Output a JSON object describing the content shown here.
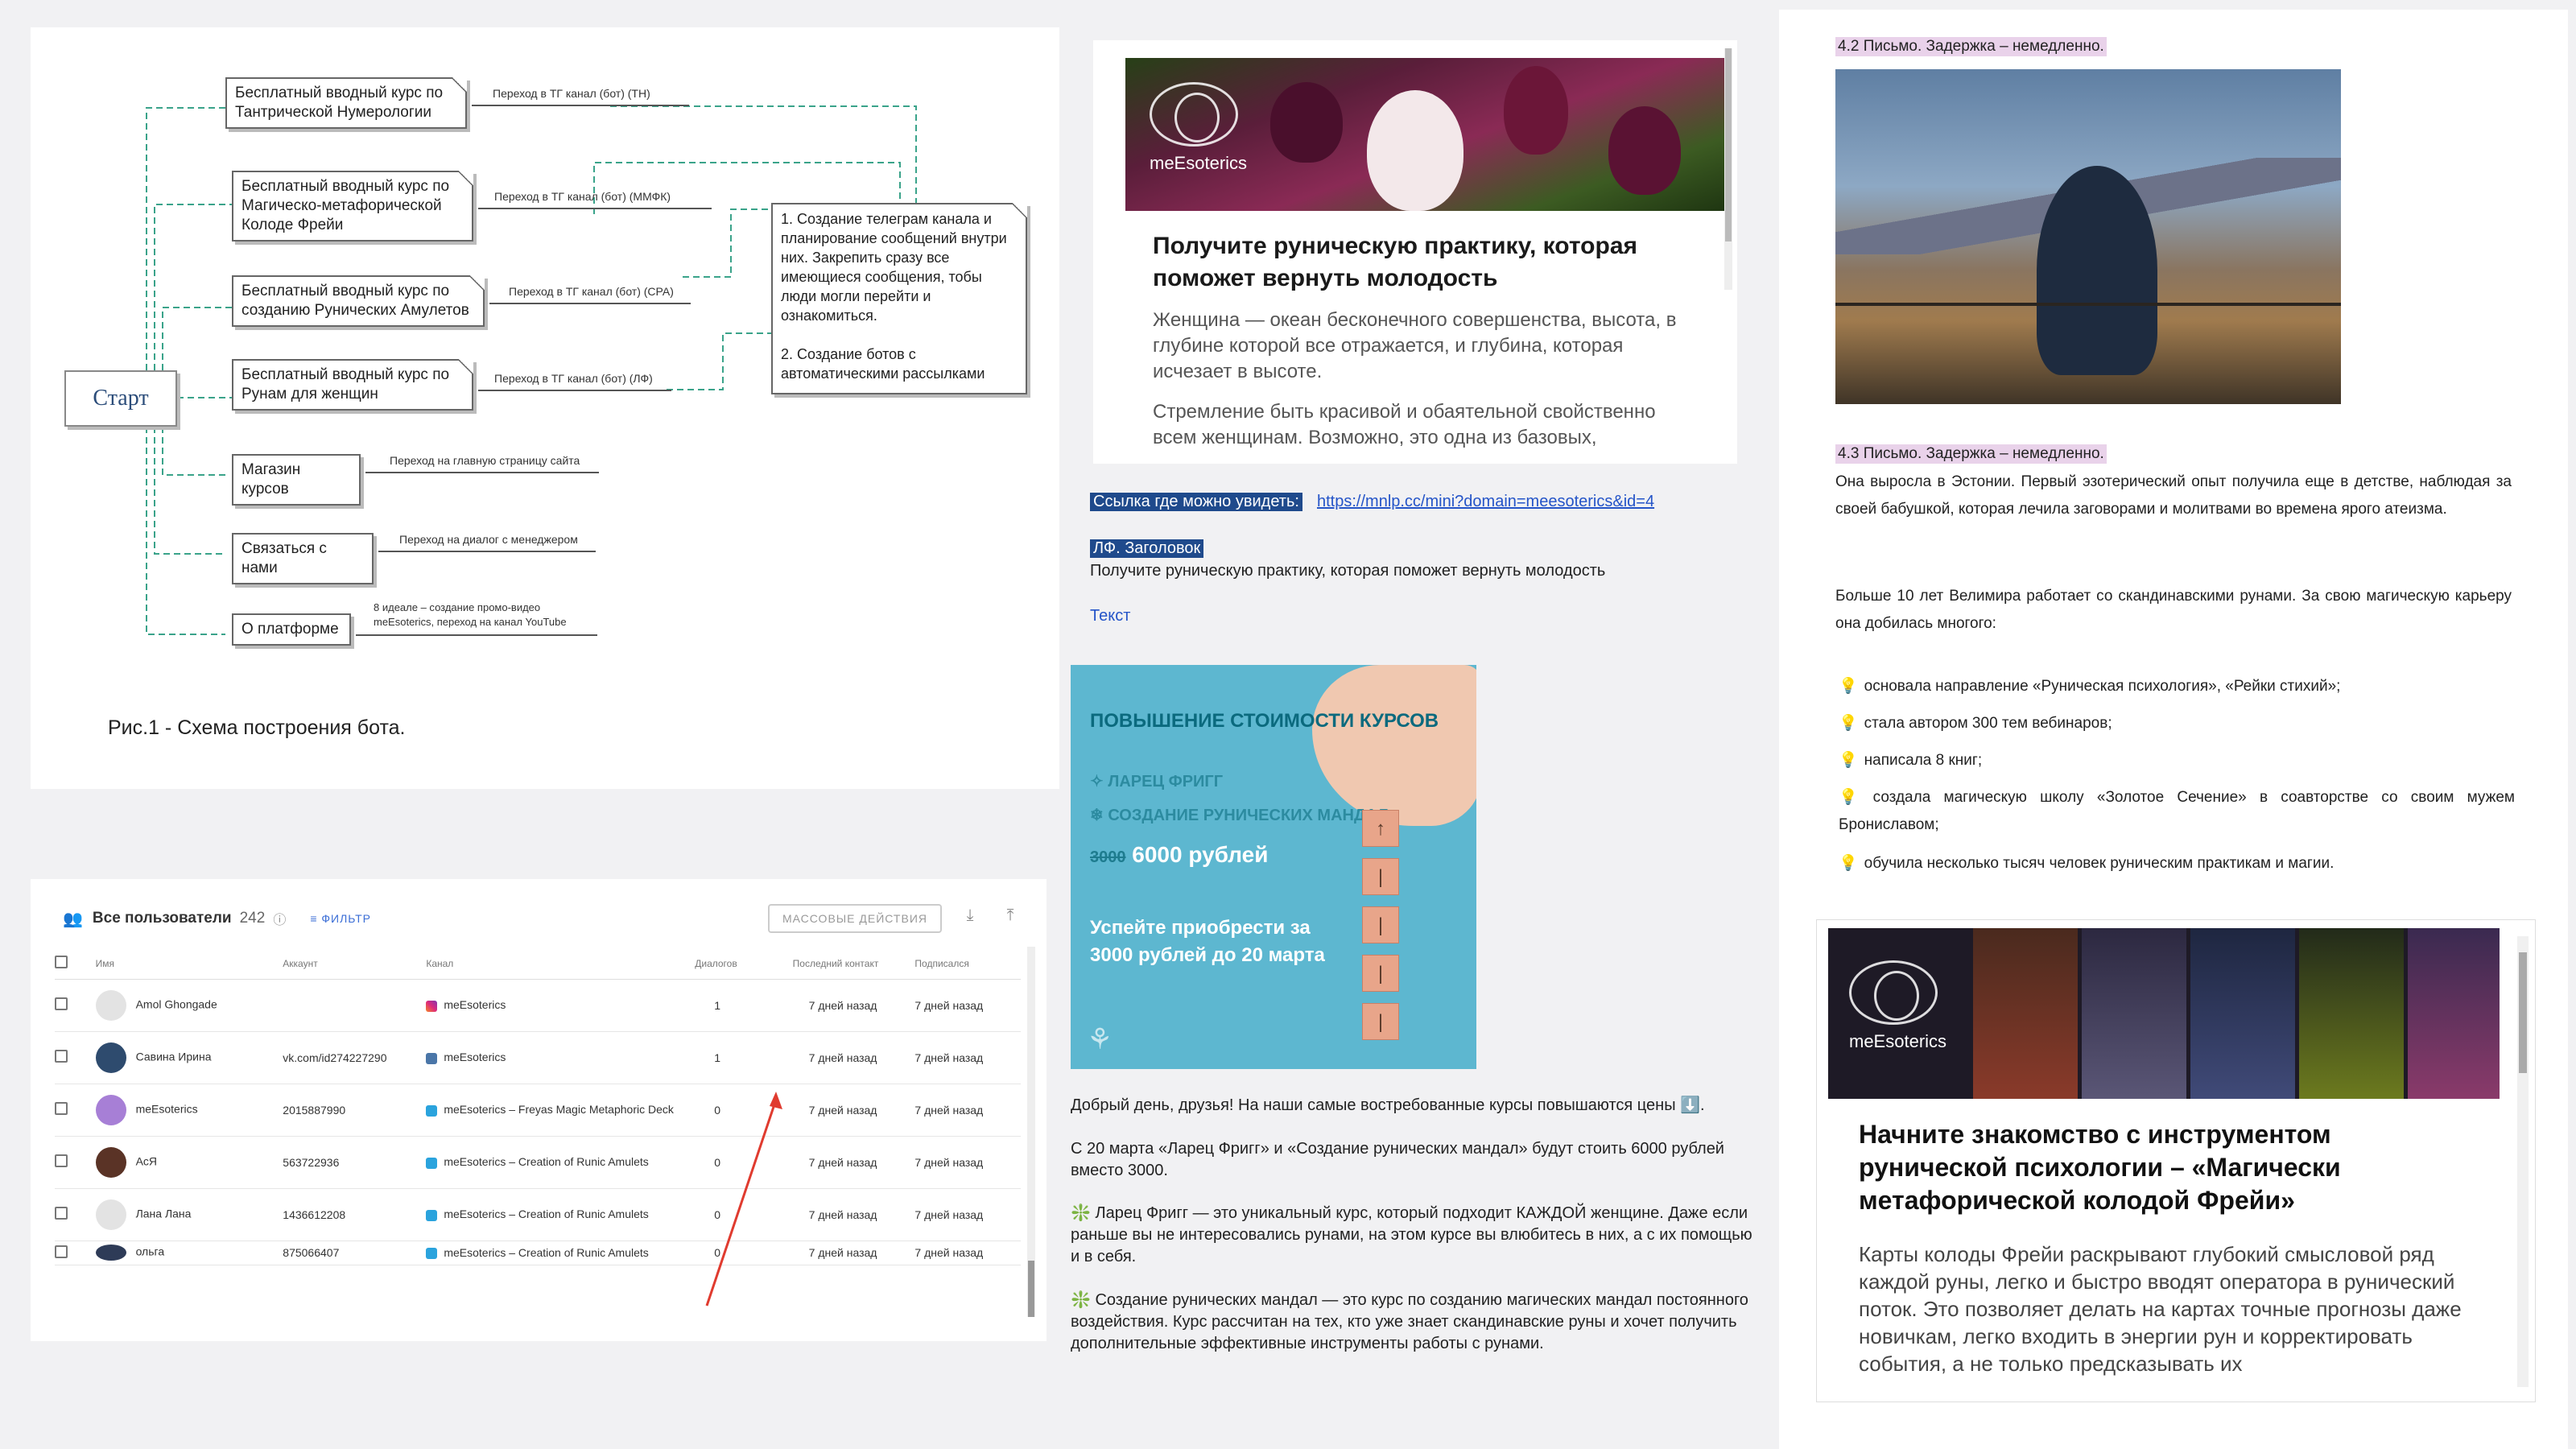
{
  "diagram": {
    "start": "Старт",
    "nodes": [
      {
        "id": "n1",
        "label": "Бесплатный вводный курс по Тантрической Нумерологии",
        "edge": "Переход в ТГ канал (бот) (ТН)"
      },
      {
        "id": "n2",
        "label": "Бесплатный вводный курс по Магическо-метафорической Колоде Фрейи",
        "edge": "Переход в ТГ канал (бот) (ММФК)"
      },
      {
        "id": "n3",
        "label": "Бесплатный вводный курс по созданию Рунических Амулетов",
        "edge": "Переход в ТГ канал (бот) (СРА)"
      },
      {
        "id": "n4",
        "label": "Бесплатный вводный курс по Рунам для женщин",
        "edge": "Переход в ТГ канал (бот) (ЛФ)"
      },
      {
        "id": "n5",
        "label": "Магазин курсов",
        "edge": "Переход на главную страницу сайта"
      },
      {
        "id": "n6",
        "label": "Связаться с нами",
        "edge": "Переход на диалог с менеджером"
      },
      {
        "id": "n7",
        "label": "О платформе",
        "edge": "8 идеале – создание промо-видео meEsoterics, переход на канал YouTube"
      }
    ],
    "note": "1. Создание телеграм канала и планирование сообщений внутри них. Закрепить сразу все имеющиеся сообщения, тобы люди могли перейти и ознакомиться.\n\n2. Создание ботов с автоматическими рассылками",
    "caption": "Рис.1 - Схема построения бота."
  },
  "users": {
    "title": "Все пользователи",
    "count": "242",
    "filter": "ФИЛЬТР",
    "mass_actions": "МАССОВЫЕ ДЕЙСТВИЯ",
    "columns": [
      "Имя",
      "Аккаунт",
      "Канал",
      "Диалогов",
      "Последний контакт",
      "Подписался"
    ],
    "rows": [
      {
        "name": "Amol Ghongade",
        "account": "",
        "channel": "meEsoterics",
        "dialogs": "1",
        "last": "7 дней назад",
        "sub": "7 дней назад"
      },
      {
        "name": "Савина Ирина",
        "account": "vk.com/id274227290",
        "channel": "meEsoterics",
        "dialogs": "1",
        "last": "7 дней назад",
        "sub": "7 дней назад"
      },
      {
        "name": "meEsoterics",
        "account": "2015887990",
        "channel": "meEsoterics – Freyas Magic Metaphoric Deck",
        "dialogs": "0",
        "last": "7 дней назад",
        "sub": "7 дней назад"
      },
      {
        "name": "АсЯ",
        "account": "563722936",
        "channel": "meEsoterics – Creation of Runic Amulets",
        "dialogs": "0",
        "last": "7 дней назад",
        "sub": "7 дней назад"
      },
      {
        "name": "Лана Лана",
        "account": "1436612208",
        "channel": "meEsoterics – Creation of Runic Amulets",
        "dialogs": "0",
        "last": "7 дней назад",
        "sub": "7 дней назад"
      },
      {
        "name": "ольга",
        "account": "875066407",
        "channel": "meEsoterics – Creation of Runic Amulets",
        "dialogs": "0",
        "last": "7 дней назад",
        "sub": "7 дней назад"
      }
    ]
  },
  "email1": {
    "logo": "meEsoterics",
    "heading": "Получите руническую практику, которая поможет вернуть молодость",
    "p1": "Женщина — океан бесконечного совершенства, высота, в глубине которой все отражается, и глубина, которая исчезает в высоте.",
    "p2": "Стремление быть красивой и обаятельной свойственно всем женщинам. Возможно, это одна из базовых,"
  },
  "middle": {
    "link_label": "Ссылка где можно увидеть:",
    "link": "https://mnlp.cc/mini?domain=meesoterics&id=4",
    "lf_label": "ЛФ. Заголовок",
    "lf_text": "Получите руническую практику, которая поможет вернуть молодость",
    "text_link": "Текст"
  },
  "promo": {
    "title": "ПОВЫШЕНИЕ СТОИМОСТИ КУРСОВ",
    "item1": "ЛАРЕЦ ФРИГГ",
    "item2": "СОЗДАНИЕ РУНИЧЕСКИХ МАНДАЛ",
    "old_price": "3000",
    "new_price": "6000 рублей",
    "cta": "Успейте приобрести за 3000 рублей до 20 марта"
  },
  "middle_body": {
    "b1": "Добрый день, друзья! На наши самые востребованные курсы повышаются цены ⬇️.",
    "b2": "С 20 марта «Ларец Фригг» и «Создание рунических мандал» будут стоить 6000 рублей вместо 3000.",
    "b3": "❇️ Ларец Фригг —  это уникальный курс, который подходит КАЖДОЙ женщине. Даже если раньше вы не интересовались рунами, на этом курсе вы влюбитесь в них, а с их помощью и в себя.",
    "b4": "❇️ Создание рунических мандал — это курс по созданию магических мандал постоянного воздействия. Курс рассчитан на тех, кто уже знает скандинавские руны и хочет получить дополнительные эффективные инструменты работы с рунами."
  },
  "right": {
    "label1": "4.2 Письмо. Задержка – немедленно.",
    "label2": "4.3 Письмо. Задержка – немедленно.",
    "p1": "Она выросла в Эстонии. Первый эзотерический опыт получила еще в детстве, наблюдая за своей бабушкой, которая лечила заговорами и молитвами во времена ярого атеизма.",
    "p2": "Больше 10 лет Велимира работает со скандинавскими рунами. За свою магическую карьеру она добилась многого:",
    "list": [
      "основала направление «Руническая психология», «Рейки стихий»;",
      "стала автором 300 тем вебинаров;",
      "написала 8 книг;",
      "создала магическую школу «Золотое Сечение» в соавторстве со своим мужем Брониславом;",
      "обучила несколько тысяч человек руническим практикам и магии."
    ]
  },
  "email2": {
    "logo": "meEsoterics",
    "heading": "Начните знакомство с инструментом рунической психологии – «Магически метафорической колодой Фрейи»",
    "p": "Карты колоды Фрейи раскрывают глубокий смысловой ряд каждой руны, легко и быстро вводят оператора в рунический поток. Это позволяет делать на картах точные прогнозы даже новичкам, легко входить в энергии рун и корректировать события, а не только предсказывать их"
  }
}
